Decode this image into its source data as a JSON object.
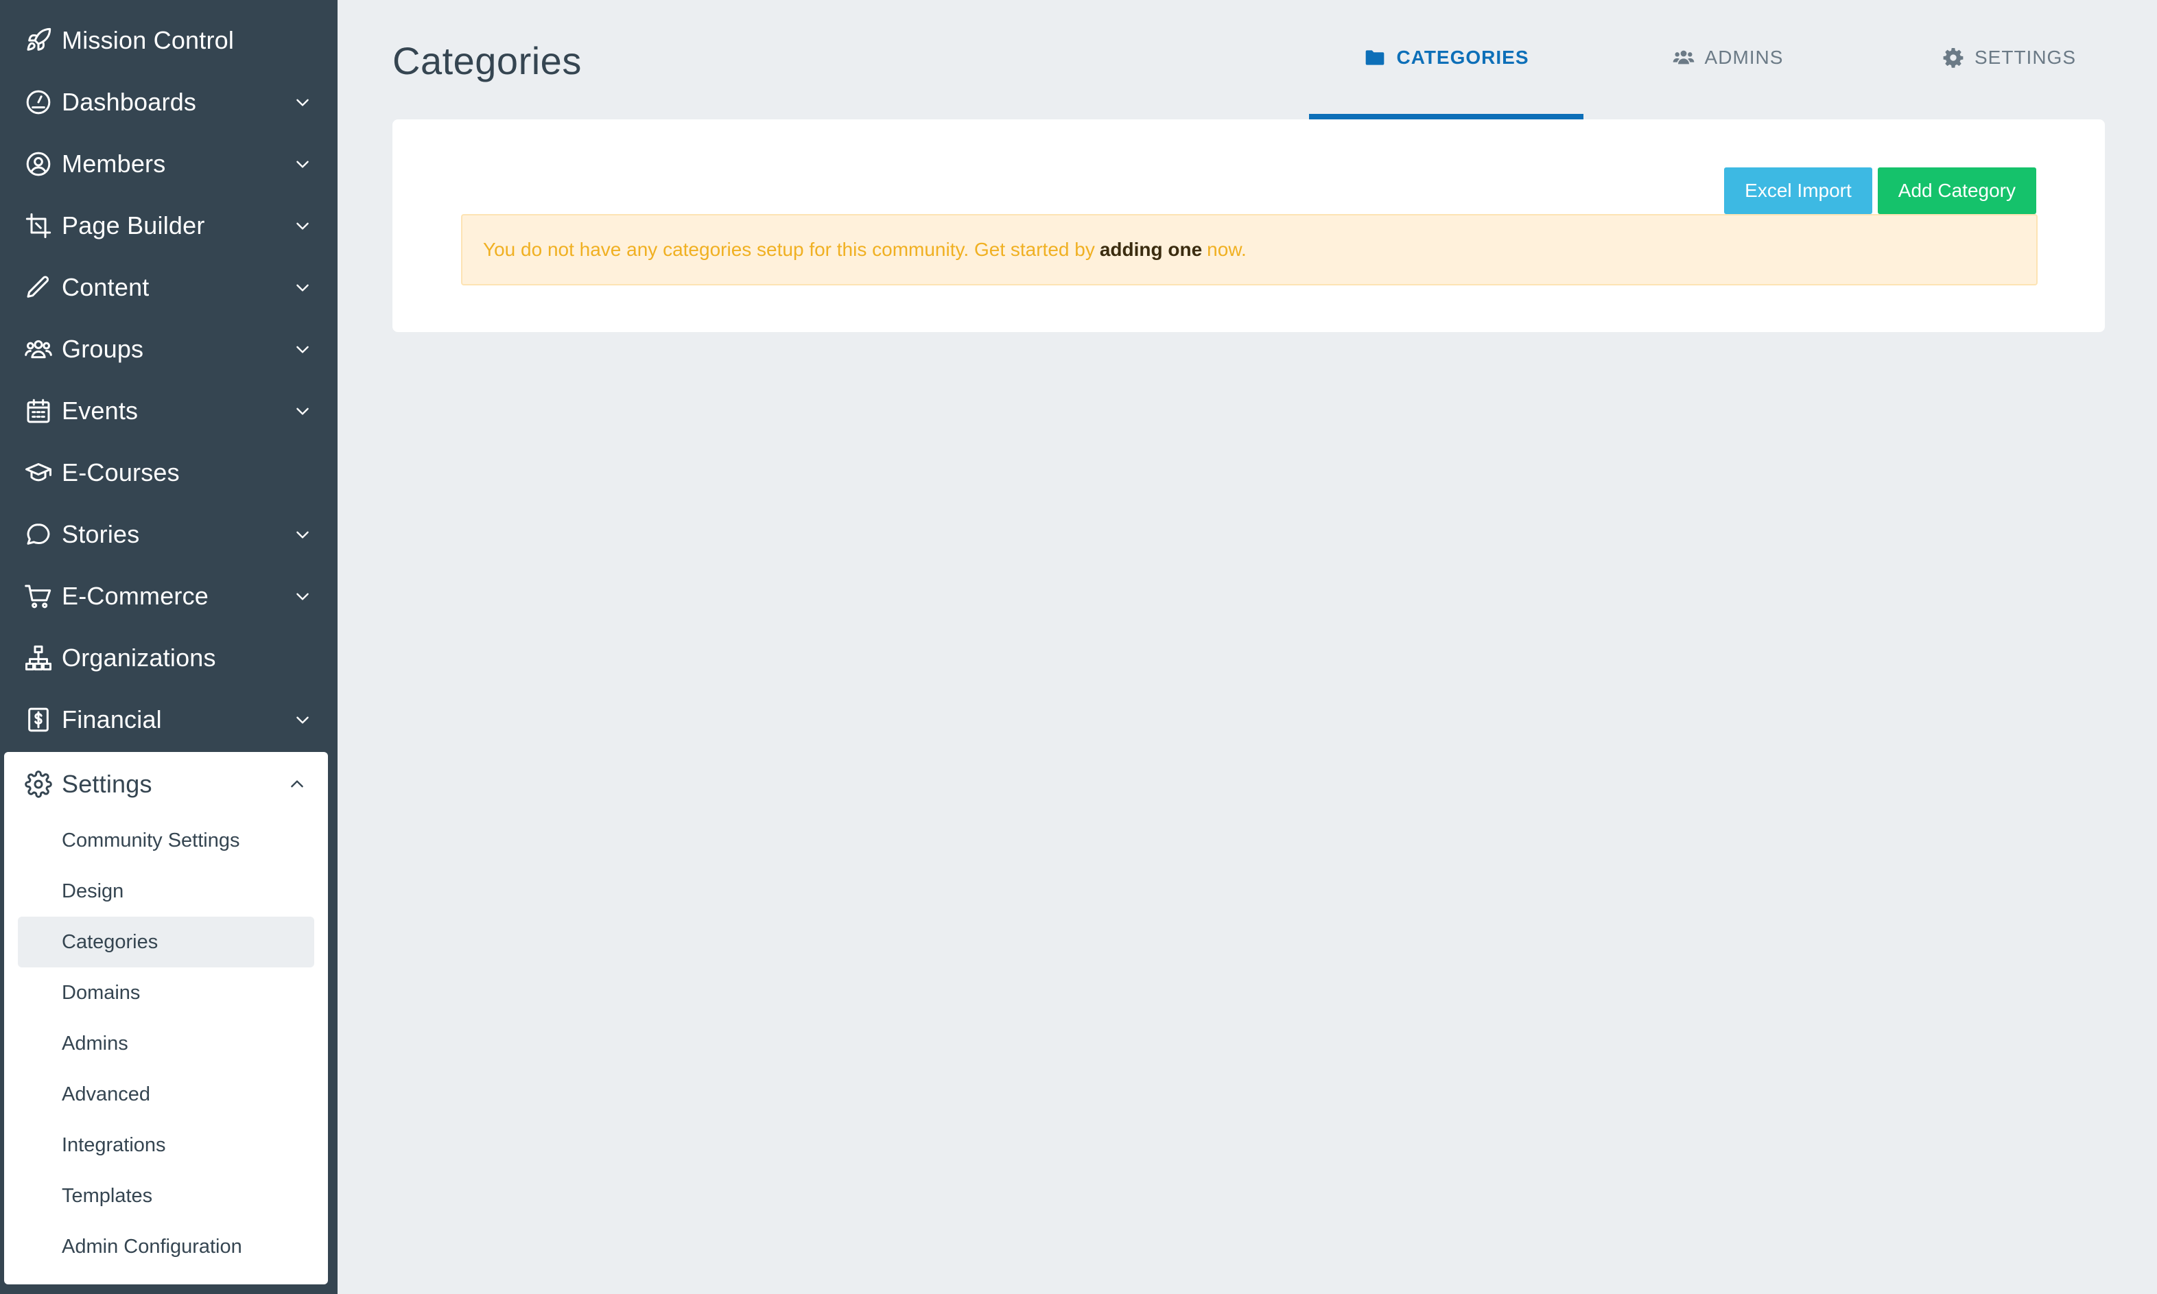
{
  "sidebar": {
    "items": [
      {
        "label": "Mission Control",
        "icon": "rocket-icon",
        "expandable": false
      },
      {
        "label": "Dashboards",
        "icon": "gauge-icon",
        "expandable": true
      },
      {
        "label": "Members",
        "icon": "user-circle-icon",
        "expandable": true
      },
      {
        "label": "Page Builder",
        "icon": "crop-icon",
        "expandable": true
      },
      {
        "label": "Content",
        "icon": "pencil-icon",
        "expandable": true
      },
      {
        "label": "Groups",
        "icon": "users-icon",
        "expandable": true
      },
      {
        "label": "Events",
        "icon": "calendar-icon",
        "expandable": true
      },
      {
        "label": "E-Courses",
        "icon": "graduation-cap-icon",
        "expandable": false
      },
      {
        "label": "Stories",
        "icon": "speech-bubble-icon",
        "expandable": true
      },
      {
        "label": "E-Commerce",
        "icon": "cart-icon",
        "expandable": true
      },
      {
        "label": "Organizations",
        "icon": "org-chart-icon",
        "expandable": false
      },
      {
        "label": "Financial",
        "icon": "dollar-icon",
        "expandable": true
      }
    ],
    "settings": {
      "label": "Settings",
      "icon": "gear-icon",
      "subitems": [
        "Community Settings",
        "Design",
        "Categories",
        "Domains",
        "Admins",
        "Advanced",
        "Integrations",
        "Templates",
        "Admin Configuration"
      ],
      "active": "Categories"
    }
  },
  "header": {
    "title": "Categories",
    "tabs": [
      {
        "label": "CATEGORIES",
        "icon": "folder-icon",
        "active": true
      },
      {
        "label": "ADMINS",
        "icon": "users-icon",
        "active": false
      },
      {
        "label": "SETTINGS",
        "icon": "gear-icon",
        "active": false
      }
    ]
  },
  "card": {
    "excel_import_label": "Excel Import",
    "add_category_label": "Add Category",
    "alert": {
      "before": "You do not have any categories setup for this community. Get started by",
      "link": "adding one",
      "after": "now."
    }
  },
  "colors": {
    "sidebar_bg": "#354551",
    "accent": "#0d6fb8",
    "info": "#3db9e3",
    "success": "#15c26b",
    "warning_text": "#f0b022",
    "warning_bg": "#fff1db"
  }
}
